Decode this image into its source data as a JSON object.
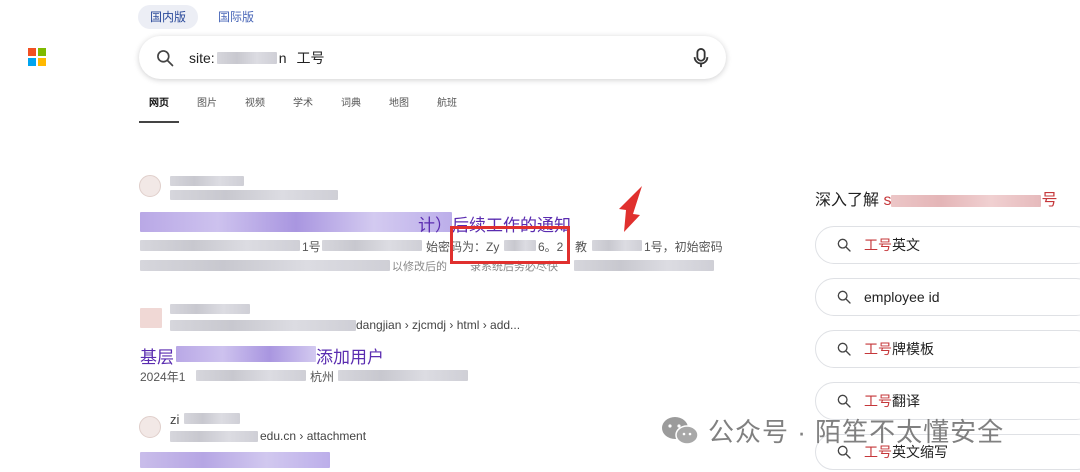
{
  "region": {
    "domestic": "国内版",
    "international": "国际版"
  },
  "search": {
    "prefix": "site:",
    "mid": "n",
    "suffix": "工号"
  },
  "tabs": [
    "网页",
    "图片",
    "视频",
    "学术",
    "词典",
    "地图",
    "航班"
  ],
  "results": [
    {
      "title_end": "计）后续工作的通知",
      "snippet1_a": "1号",
      "snippet1_b": "始密码为：Zy",
      "snippet1_c": "6。2",
      "snippet1_d": "教",
      "snippet1_e": "1号，初始密码",
      "snippet2_a": "以修改后的",
      "snippet2_b": "录系统后务必尽快"
    },
    {
      "breadcrumb": "dangjian › zjcmdj › html › add...",
      "title_start": "基层",
      "title_end": "添加用户",
      "snippet_date": "2024年1",
      "snippet_b": "杭州"
    },
    {
      "site_prefix": "zi",
      "breadcrumb": "edu.cn › attachment"
    }
  ],
  "side": {
    "title_prefix": "深入了解 ",
    "title_accent_start": "s",
    "title_accent_end": "号",
    "suggestions": [
      {
        "hl": "工号",
        "rest": "英文"
      },
      {
        "hl": "",
        "rest": "employee id"
      },
      {
        "hl": "工号",
        "rest": "牌模板"
      },
      {
        "hl": "工号",
        "rest": "翻译"
      },
      {
        "hl": "工号",
        "rest": "英文缩写"
      }
    ]
  },
  "watermark": {
    "text": "公众号 · 陌笙不太懂安全"
  },
  "colors": {
    "accent_red": "#c5373a",
    "link_purple": "#5a2cb0",
    "annotation_red": "#e0302e"
  }
}
